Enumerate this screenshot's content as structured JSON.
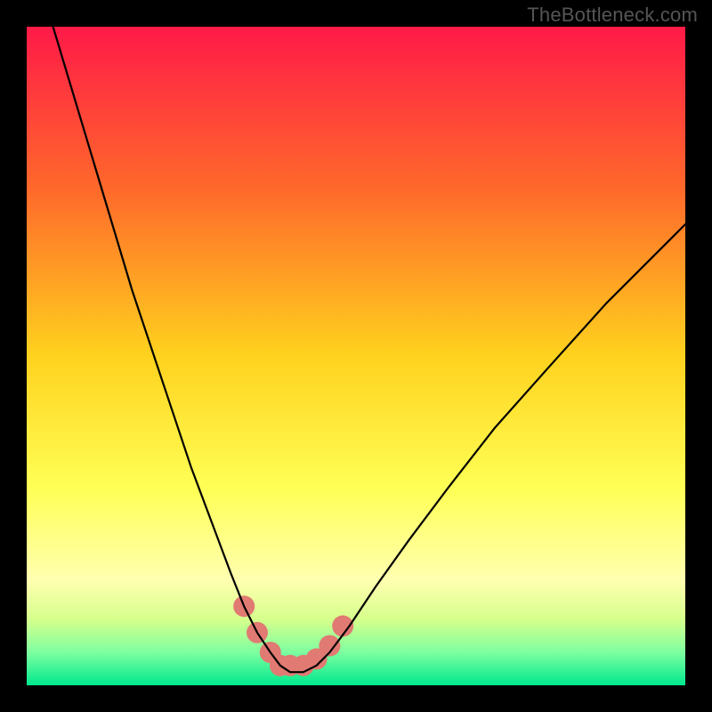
{
  "watermark": "TheBottleneck.com",
  "chart_data": {
    "type": "line",
    "title": "",
    "xlabel": "",
    "ylabel": "",
    "xlim": [
      0,
      100
    ],
    "ylim": [
      0,
      100
    ],
    "background": {
      "kind": "vertical-gradient",
      "stops": [
        {
          "pos": 0,
          "color": "#ff1a48"
        },
        {
          "pos": 25,
          "color": "#ff6a2a"
        },
        {
          "pos": 50,
          "color": "#ffd21e"
        },
        {
          "pos": 70,
          "color": "#ffff55"
        },
        {
          "pos": 84,
          "color": "#ffffb0"
        },
        {
          "pos": 90,
          "color": "#d6ff8c"
        },
        {
          "pos": 95,
          "color": "#7dffa0"
        },
        {
          "pos": 100,
          "color": "#00e88e"
        }
      ]
    },
    "series": [
      {
        "name": "bottleneck-curve",
        "x": [
          4,
          7,
          10,
          13,
          16,
          19,
          22,
          25,
          28,
          31,
          33,
          35,
          37,
          38.5,
          40,
          42,
          44,
          46,
          49,
          53,
          58,
          64,
          71,
          79,
          88,
          98,
          100
        ],
        "values": [
          100,
          90,
          80,
          70,
          60,
          51,
          42,
          33,
          25,
          17,
          12,
          8,
          5,
          3,
          2,
          2,
          3,
          5,
          9,
          15,
          22,
          30,
          39,
          48,
          58,
          68,
          70
        ]
      }
    ],
    "markers": {
      "name": "valley-dots",
      "color": "#e07a72",
      "x": [
        33,
        35,
        37,
        38.5,
        40,
        42,
        44,
        46,
        48
      ],
      "values": [
        12,
        8,
        5,
        3,
        3,
        3,
        4,
        6,
        9
      ],
      "radius": 12
    }
  }
}
